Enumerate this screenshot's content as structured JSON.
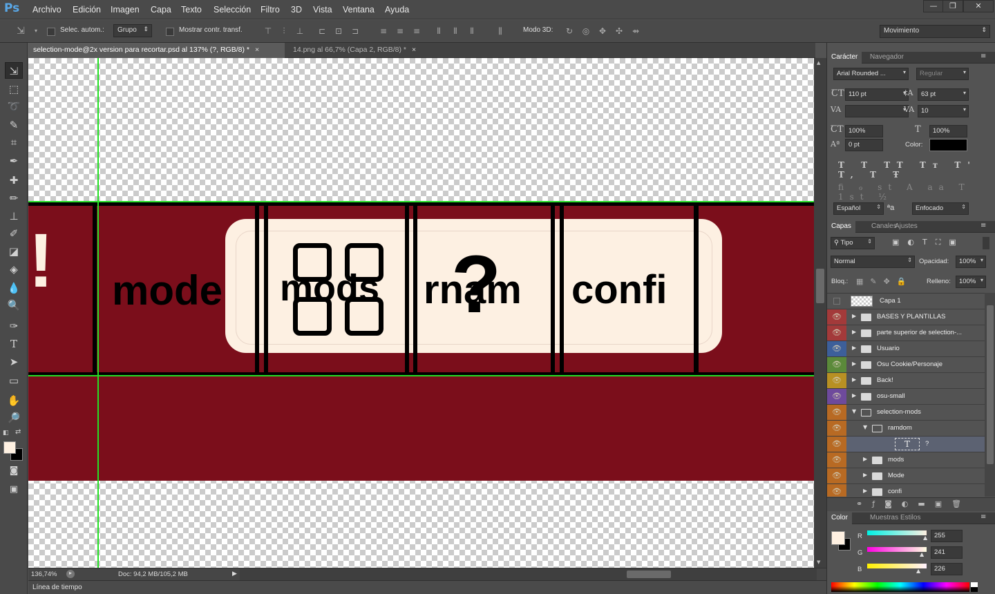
{
  "app": {
    "logo": "Ps"
  },
  "menu": [
    "Archivo",
    "Edición",
    "Imagen",
    "Capa",
    "Texto",
    "Selección",
    "Filtro",
    "3D",
    "Vista",
    "Ventana",
    "Ayuda"
  ],
  "window_controls": {
    "minimize": "—",
    "restore": "❐",
    "close": "✕"
  },
  "options": {
    "auto_select_label": "Selec. autom.:",
    "auto_select_value": "Grupo",
    "show_transform_label": "Mostrar contr. transf.",
    "mode3d_label": "Modo 3D:",
    "workspace": "Movimiento"
  },
  "tabs": [
    {
      "label": "selection-mode@2x version para recortar.psd al 137% (?, RGB/8) *",
      "close": "×"
    },
    {
      "label": "14.png al 66,7% (Capa 2, RGB/8) *",
      "close": "×"
    }
  ],
  "canvas": {
    "texts": {
      "mode": "mode",
      "mods": "mods",
      "rnam": "rnam",
      "confi": "confi",
      "question": "?",
      "excl": "!"
    },
    "colors": {
      "band": "#7b0e1b",
      "pill": "#fdf0e2",
      "guide": "#25e025"
    }
  },
  "status": {
    "zoom": "136,74%",
    "doc": "Doc: 94,2 MB/105,2 MB",
    "timeline": "Línea de tiempo"
  },
  "character": {
    "tabs": [
      "Carácter",
      "Navegador"
    ],
    "font": "Arial Rounded ...",
    "style": "Regular",
    "size": "110 pt",
    "leading": "63 pt",
    "kerning": "",
    "tracking": "10",
    "vscale": "100%",
    "hscale": "100%",
    "baseline": "0 pt",
    "color_label": "Color:",
    "language": "Español",
    "antialias_icon": "ªa",
    "antialias": "Enfocado"
  },
  "layers": {
    "tabs": [
      "Capas",
      "Canales",
      "Ajustes"
    ],
    "filter": "Tipo",
    "blend": "Normal",
    "opacity_label": "Opacidad:",
    "opacity": "100%",
    "lock_label": "Bloq.:",
    "fill_label": "Relleno:",
    "fill": "100%",
    "items": [
      {
        "name": "Capa 1",
        "type": "layer",
        "color": "#535353",
        "visible": false,
        "indent": 0
      },
      {
        "name": "BASES Y PLANTILLAS",
        "type": "group",
        "color": "#a33a3a",
        "visible": true,
        "indent": 0
      },
      {
        "name": "parte superior de selection-...",
        "type": "group",
        "color": "#a33a3a",
        "visible": true,
        "indent": 0
      },
      {
        "name": "Usuario",
        "type": "group",
        "color": "#3d5f9a",
        "visible": true,
        "indent": 0
      },
      {
        "name": "Osu Cookie/Personaje",
        "type": "group",
        "color": "#5b8a3a",
        "visible": true,
        "indent": 0
      },
      {
        "name": "Back!",
        "type": "group",
        "color": "#b89023",
        "visible": true,
        "indent": 0
      },
      {
        "name": "osu-small",
        "type": "group",
        "color": "#6e4a9c",
        "visible": true,
        "indent": 0
      },
      {
        "name": "selection-mods",
        "type": "group-open",
        "color": "#b86a23",
        "visible": true,
        "indent": 0
      },
      {
        "name": "ramdom",
        "type": "group-open",
        "color": "#b86a23",
        "visible": true,
        "indent": 1
      },
      {
        "name": "?",
        "type": "text",
        "color": "#b86a23",
        "visible": true,
        "indent": 2
      },
      {
        "name": "mods",
        "type": "group",
        "color": "#b86a23",
        "visible": true,
        "indent": 1
      },
      {
        "name": "Mode",
        "type": "group",
        "color": "#b86a23",
        "visible": true,
        "indent": 1
      },
      {
        "name": "confi",
        "type": "group",
        "color": "#b86a23",
        "visible": true,
        "indent": 1
      }
    ]
  },
  "color_panel": {
    "tabs": [
      "Color",
      "Muestras",
      "Estilos"
    ],
    "r_label": "R",
    "g_label": "G",
    "b_label": "B",
    "r": "255",
    "g": "241",
    "b": "226",
    "foreground": "#fff1e2",
    "background": "#000000"
  }
}
